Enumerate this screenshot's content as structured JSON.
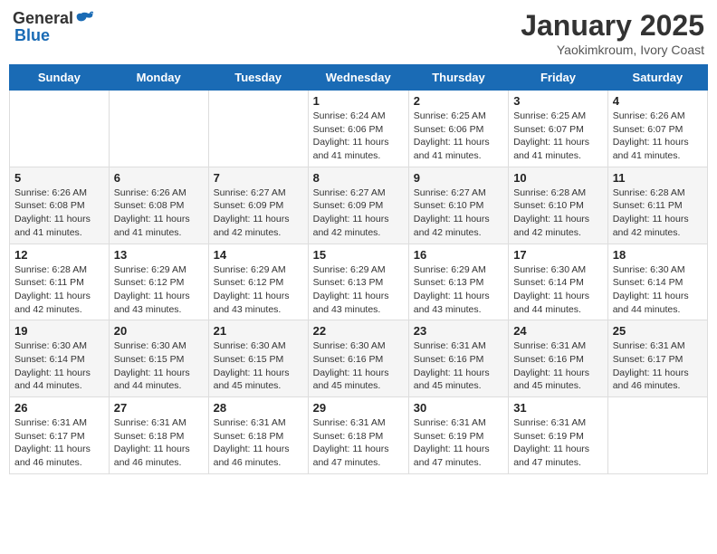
{
  "logo": {
    "general": "General",
    "blue": "Blue"
  },
  "title": "January 2025",
  "subtitle": "Yaokimkroum, Ivory Coast",
  "weekdays": [
    "Sunday",
    "Monday",
    "Tuesday",
    "Wednesday",
    "Thursday",
    "Friday",
    "Saturday"
  ],
  "weeks": [
    [
      {
        "day": "",
        "info": ""
      },
      {
        "day": "",
        "info": ""
      },
      {
        "day": "",
        "info": ""
      },
      {
        "day": "1",
        "sunrise": "Sunrise: 6:24 AM",
        "sunset": "Sunset: 6:06 PM",
        "daylight": "Daylight: 11 hours and 41 minutes."
      },
      {
        "day": "2",
        "sunrise": "Sunrise: 6:25 AM",
        "sunset": "Sunset: 6:06 PM",
        "daylight": "Daylight: 11 hours and 41 minutes."
      },
      {
        "day": "3",
        "sunrise": "Sunrise: 6:25 AM",
        "sunset": "Sunset: 6:07 PM",
        "daylight": "Daylight: 11 hours and 41 minutes."
      },
      {
        "day": "4",
        "sunrise": "Sunrise: 6:26 AM",
        "sunset": "Sunset: 6:07 PM",
        "daylight": "Daylight: 11 hours and 41 minutes."
      }
    ],
    [
      {
        "day": "5",
        "sunrise": "Sunrise: 6:26 AM",
        "sunset": "Sunset: 6:08 PM",
        "daylight": "Daylight: 11 hours and 41 minutes."
      },
      {
        "day": "6",
        "sunrise": "Sunrise: 6:26 AM",
        "sunset": "Sunset: 6:08 PM",
        "daylight": "Daylight: 11 hours and 41 minutes."
      },
      {
        "day": "7",
        "sunrise": "Sunrise: 6:27 AM",
        "sunset": "Sunset: 6:09 PM",
        "daylight": "Daylight: 11 hours and 42 minutes."
      },
      {
        "day": "8",
        "sunrise": "Sunrise: 6:27 AM",
        "sunset": "Sunset: 6:09 PM",
        "daylight": "Daylight: 11 hours and 42 minutes."
      },
      {
        "day": "9",
        "sunrise": "Sunrise: 6:27 AM",
        "sunset": "Sunset: 6:10 PM",
        "daylight": "Daylight: 11 hours and 42 minutes."
      },
      {
        "day": "10",
        "sunrise": "Sunrise: 6:28 AM",
        "sunset": "Sunset: 6:10 PM",
        "daylight": "Daylight: 11 hours and 42 minutes."
      },
      {
        "day": "11",
        "sunrise": "Sunrise: 6:28 AM",
        "sunset": "Sunset: 6:11 PM",
        "daylight": "Daylight: 11 hours and 42 minutes."
      }
    ],
    [
      {
        "day": "12",
        "sunrise": "Sunrise: 6:28 AM",
        "sunset": "Sunset: 6:11 PM",
        "daylight": "Daylight: 11 hours and 42 minutes."
      },
      {
        "day": "13",
        "sunrise": "Sunrise: 6:29 AM",
        "sunset": "Sunset: 6:12 PM",
        "daylight": "Daylight: 11 hours and 43 minutes."
      },
      {
        "day": "14",
        "sunrise": "Sunrise: 6:29 AM",
        "sunset": "Sunset: 6:12 PM",
        "daylight": "Daylight: 11 hours and 43 minutes."
      },
      {
        "day": "15",
        "sunrise": "Sunrise: 6:29 AM",
        "sunset": "Sunset: 6:13 PM",
        "daylight": "Daylight: 11 hours and 43 minutes."
      },
      {
        "day": "16",
        "sunrise": "Sunrise: 6:29 AM",
        "sunset": "Sunset: 6:13 PM",
        "daylight": "Daylight: 11 hours and 43 minutes."
      },
      {
        "day": "17",
        "sunrise": "Sunrise: 6:30 AM",
        "sunset": "Sunset: 6:14 PM",
        "daylight": "Daylight: 11 hours and 44 minutes."
      },
      {
        "day": "18",
        "sunrise": "Sunrise: 6:30 AM",
        "sunset": "Sunset: 6:14 PM",
        "daylight": "Daylight: 11 hours and 44 minutes."
      }
    ],
    [
      {
        "day": "19",
        "sunrise": "Sunrise: 6:30 AM",
        "sunset": "Sunset: 6:14 PM",
        "daylight": "Daylight: 11 hours and 44 minutes."
      },
      {
        "day": "20",
        "sunrise": "Sunrise: 6:30 AM",
        "sunset": "Sunset: 6:15 PM",
        "daylight": "Daylight: 11 hours and 44 minutes."
      },
      {
        "day": "21",
        "sunrise": "Sunrise: 6:30 AM",
        "sunset": "Sunset: 6:15 PM",
        "daylight": "Daylight: 11 hours and 45 minutes."
      },
      {
        "day": "22",
        "sunrise": "Sunrise: 6:30 AM",
        "sunset": "Sunset: 6:16 PM",
        "daylight": "Daylight: 11 hours and 45 minutes."
      },
      {
        "day": "23",
        "sunrise": "Sunrise: 6:31 AM",
        "sunset": "Sunset: 6:16 PM",
        "daylight": "Daylight: 11 hours and 45 minutes."
      },
      {
        "day": "24",
        "sunrise": "Sunrise: 6:31 AM",
        "sunset": "Sunset: 6:16 PM",
        "daylight": "Daylight: 11 hours and 45 minutes."
      },
      {
        "day": "25",
        "sunrise": "Sunrise: 6:31 AM",
        "sunset": "Sunset: 6:17 PM",
        "daylight": "Daylight: 11 hours and 46 minutes."
      }
    ],
    [
      {
        "day": "26",
        "sunrise": "Sunrise: 6:31 AM",
        "sunset": "Sunset: 6:17 PM",
        "daylight": "Daylight: 11 hours and 46 minutes."
      },
      {
        "day": "27",
        "sunrise": "Sunrise: 6:31 AM",
        "sunset": "Sunset: 6:18 PM",
        "daylight": "Daylight: 11 hours and 46 minutes."
      },
      {
        "day": "28",
        "sunrise": "Sunrise: 6:31 AM",
        "sunset": "Sunset: 6:18 PM",
        "daylight": "Daylight: 11 hours and 46 minutes."
      },
      {
        "day": "29",
        "sunrise": "Sunrise: 6:31 AM",
        "sunset": "Sunset: 6:18 PM",
        "daylight": "Daylight: 11 hours and 47 minutes."
      },
      {
        "day": "30",
        "sunrise": "Sunrise: 6:31 AM",
        "sunset": "Sunset: 6:19 PM",
        "daylight": "Daylight: 11 hours and 47 minutes."
      },
      {
        "day": "31",
        "sunrise": "Sunrise: 6:31 AM",
        "sunset": "Sunset: 6:19 PM",
        "daylight": "Daylight: 11 hours and 47 minutes."
      },
      {
        "day": "",
        "info": ""
      }
    ]
  ],
  "accent_color": "#1a6bb5"
}
